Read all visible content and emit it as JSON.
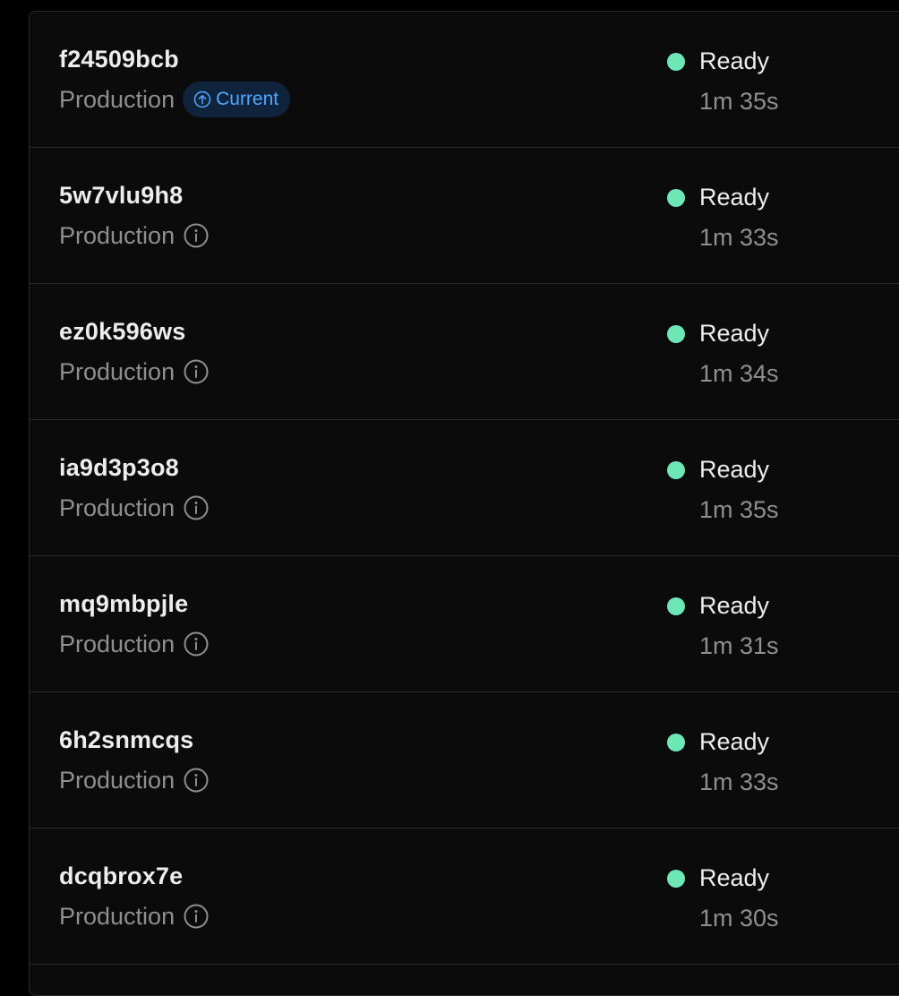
{
  "colors": {
    "background": "#000000",
    "panel": "#0b0b0b",
    "border": "#2a2a2a",
    "ready": "#6ee7b7",
    "badge_bg": "#10233d",
    "badge_text": "#52a8ff"
  },
  "deployments": [
    {
      "id": "f24509bcb",
      "environment": "Production",
      "current": true,
      "badge_label": "Current",
      "badge_icon": "arrow-up-circle-icon",
      "status": "Ready",
      "duration": "1m 35s"
    },
    {
      "id": "5w7vlu9h8",
      "environment": "Production",
      "current": false,
      "info_icon": "info-icon",
      "status": "Ready",
      "duration": "1m 33s"
    },
    {
      "id": "ez0k596ws",
      "environment": "Production",
      "current": false,
      "info_icon": "info-icon",
      "status": "Ready",
      "duration": "1m 34s"
    },
    {
      "id": "ia9d3p3o8",
      "environment": "Production",
      "current": false,
      "info_icon": "info-icon",
      "status": "Ready",
      "duration": "1m 35s"
    },
    {
      "id": "mq9mbpjle",
      "environment": "Production",
      "current": false,
      "info_icon": "info-icon",
      "status": "Ready",
      "duration": "1m 31s"
    },
    {
      "id": "6h2snmcqs",
      "environment": "Production",
      "current": false,
      "info_icon": "info-icon",
      "status": "Ready",
      "duration": "1m 33s"
    },
    {
      "id": "dcqbrox7e",
      "environment": "Production",
      "current": false,
      "info_icon": "info-icon",
      "status": "Ready",
      "duration": "1m 30s"
    }
  ]
}
